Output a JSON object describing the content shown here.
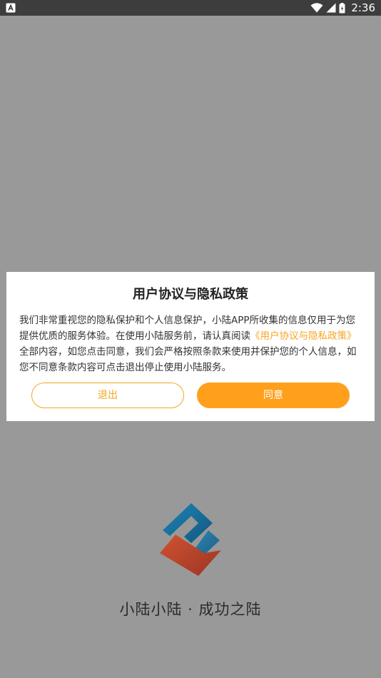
{
  "status_bar": {
    "time": "2:36",
    "icons": [
      "app-notification-icon",
      "wifi-icon",
      "signal-icon",
      "battery-icon"
    ]
  },
  "dialog": {
    "title": "用户协议与隐私政策",
    "body_before": "我们非常重视您的隐私保护和个人信息保护，小陆APP所收集的信息仅用于为您提供优质的服务体验。在使用小陆服务前，请认真阅读",
    "body_link": "《用户协议与隐私政策》",
    "body_after": "全部内容，如您点击同意，我们会严格按照条款来使用并保护您的个人信息，如您不同意条款内容可点击退出停止使用小陆服务。",
    "exit_label": "退出",
    "agree_label": "同意"
  },
  "splash": {
    "slogan": "小陆小陆 · 成功之陆"
  },
  "colors": {
    "overlay": "#999999",
    "accent": "#ffa01c",
    "link": "#f5a623",
    "logo_blue": "#1a6fa0",
    "logo_red": "#b8432b"
  }
}
